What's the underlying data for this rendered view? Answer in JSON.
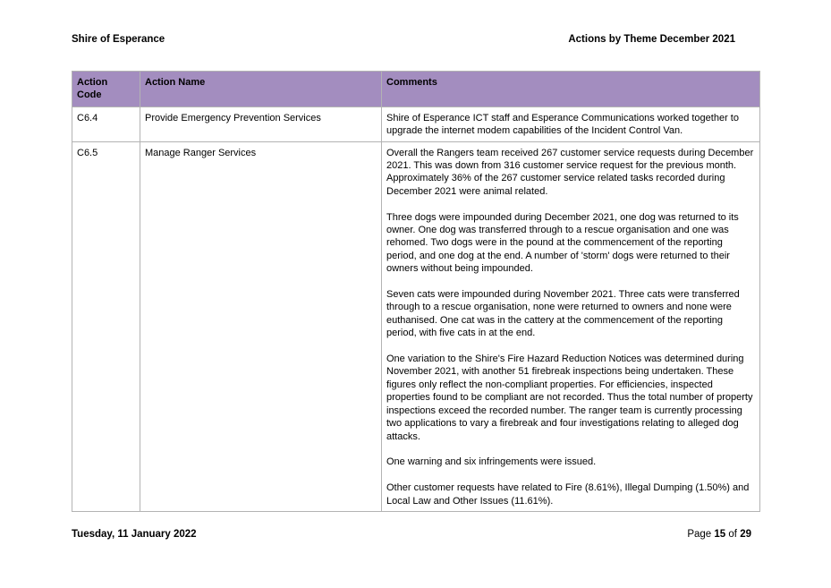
{
  "header": {
    "org": "Shire of Esperance",
    "title": "Actions by Theme December 2021"
  },
  "table": {
    "columns": [
      "Action Code",
      "Action Name",
      "Comments"
    ],
    "rows": [
      {
        "code": "C6.4",
        "name": "Provide Emergency Prevention Services",
        "comments": [
          "Shire of Esperance ICT staff and Esperance Communications worked together to upgrade the internet modem capabilities of the Incident Control Van."
        ]
      },
      {
        "code": "C6.5",
        "name": "Manage Ranger Services",
        "comments": [
          "Overall the Rangers team received 267 customer service requests during December 2021. This was down from 316 customer service request for the previous month. Approximately 36% of the 267 customer service related tasks recorded during December 2021 were animal related.",
          "Three dogs were impounded during December 2021, one dog was returned to its owner. One dog was transferred through to a rescue organisation and one was rehomed. Two dogs were in the pound at the commencement of the reporting period, and one dog at the end. A number of 'storm' dogs were returned to their owners without being impounded.",
          "Seven cats were impounded during November 2021. Three cats were transferred through to a rescue organisation, none were returned to owners and none were euthanised. One cat was in the cattery at the commencement of the reporting period, with five cats in at the end.",
          "One variation to the Shire's Fire Hazard Reduction Notices was determined during November 2021, with another 51 firebreak inspections being undertaken. These figures only reflect the non-compliant properties. For efficiencies, inspected properties found to be compliant are not recorded. Thus the total number of property inspections exceed the recorded number. The ranger team is currently processing two applications to vary a firebreak and four investigations relating to alleged dog attacks.",
          "One warning and six infringements were issued.",
          "Other customer requests have related to Fire (8.61%), Illegal Dumping (1.50%) and Local Law and Other Issues (11.61%)."
        ]
      }
    ]
  },
  "footer": {
    "date": "Tuesday, 11 January 2022",
    "page_prefix": "Page",
    "page_current": "15",
    "page_of": "of",
    "page_total": "29"
  },
  "colors": {
    "header_fill": "#a38dbf",
    "border": "#b3b3b3"
  }
}
